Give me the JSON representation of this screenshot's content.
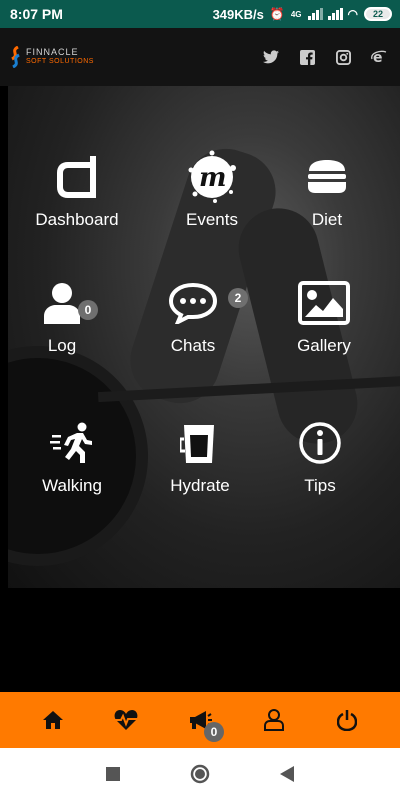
{
  "status_bar": {
    "time": "8:07 PM",
    "net_speed": "349KB/s",
    "net_type": "4G",
    "battery": "22"
  },
  "header": {
    "logo_line1": "FINNACLE",
    "logo_line2": "SOFT SOLUTIONS",
    "social_icons": [
      "twitter-icon",
      "facebook-icon",
      "instagram-icon",
      "internet-explorer-icon"
    ]
  },
  "menu": {
    "dashboard": {
      "label": "Dashboard",
      "icon": "dashboard-icon"
    },
    "events": {
      "label": "Events",
      "icon": "meetup-icon"
    },
    "diet": {
      "label": "Diet",
      "icon": "burger-icon"
    },
    "log": {
      "label": "Log",
      "icon": "user-icon",
      "badge": "0"
    },
    "chats": {
      "label": "Chats",
      "icon": "chat-icon",
      "badge": "2"
    },
    "gallery": {
      "label": "Gallery",
      "icon": "image-icon"
    },
    "walking": {
      "label": "Walking",
      "icon": "running-icon"
    },
    "hydrate": {
      "label": "Hydrate",
      "icon": "glass-icon"
    },
    "tips": {
      "label": "Tips",
      "icon": "info-icon"
    }
  },
  "bottom_nav": {
    "items": [
      "home-icon",
      "heartbeat-icon",
      "megaphone-icon",
      "user-outline-icon",
      "power-icon"
    ],
    "announcements_badge": "0"
  },
  "colors": {
    "status_bar": "#0b5a4e",
    "accent": "#ff7a00",
    "badge": "#6f6f6f"
  }
}
